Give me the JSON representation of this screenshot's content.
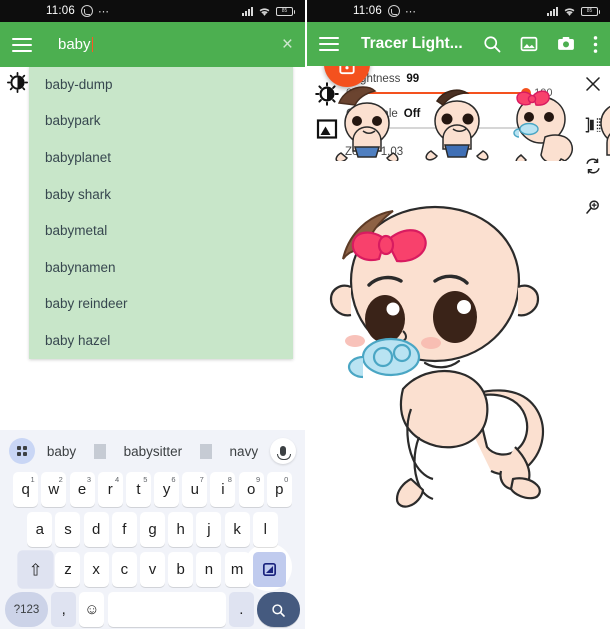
{
  "status_bar": {
    "time": "11:06",
    "battery_level": "85",
    "icons": [
      "whatsapp-icon",
      "more-dots-icon",
      "signal-icon",
      "wifi-icon",
      "battery-icon"
    ]
  },
  "left_panel": {
    "search": {
      "value": "baby",
      "clear_label": "×"
    },
    "menu_label": "menu-icon",
    "suggestions": [
      "baby-dump",
      "babypark",
      "babyplanet",
      "baby shark",
      "babymetal",
      "babynamen",
      "baby reindeer",
      "baby hazel"
    ]
  },
  "keyboard": {
    "suggestions": [
      "baby",
      "babysitter",
      "navy"
    ],
    "row1": [
      {
        "k": "q",
        "n": "1"
      },
      {
        "k": "w",
        "n": "2"
      },
      {
        "k": "e",
        "n": "3"
      },
      {
        "k": "r",
        "n": "4"
      },
      {
        "k": "t",
        "n": "5"
      },
      {
        "k": "y",
        "n": "6"
      },
      {
        "k": "u",
        "n": "7"
      },
      {
        "k": "i",
        "n": "8"
      },
      {
        "k": "o",
        "n": "9"
      },
      {
        "k": "p",
        "n": "0"
      }
    ],
    "row2": [
      "a",
      "s",
      "d",
      "f",
      "g",
      "h",
      "j",
      "k",
      "l"
    ],
    "row3": [
      "z",
      "x",
      "c",
      "v",
      "b",
      "n",
      "m"
    ],
    "shift_label": "⇧",
    "delete_label": "delete-key",
    "num_label": "?123",
    "comma_label": ",",
    "emoji_label": "☺",
    "period_label": ".",
    "search_label": "search-key",
    "mic_label": "mic-icon"
  },
  "right_panel": {
    "title": "Tracer Light...",
    "bar_icons": [
      "search-icon",
      "gallery-icon",
      "camera-icon",
      "overflow-menu-icon"
    ],
    "brightness": {
      "label": "Brightness",
      "value": "99",
      "min": "0",
      "max": "100",
      "percent": 99
    },
    "greyscale": {
      "label": "Greyscale",
      "value": "Off",
      "min": "0",
      "max": "100",
      "percent": 2
    },
    "zoom_text": "Zoom: 1,03",
    "tools": [
      "close-icon",
      "mirror-icon",
      "rotate-icon",
      "zoom-icon"
    ],
    "url": "https://mungfali.com/post/1A0",
    "fab_label": "unlock-icon"
  },
  "colors": {
    "green": "#4caf50",
    "suggest_bg": "#c8e6c9",
    "accent_orange": "#f4511e",
    "keyboard_bg": "#f1f3f9",
    "status_bg": "#0d0d0d"
  }
}
